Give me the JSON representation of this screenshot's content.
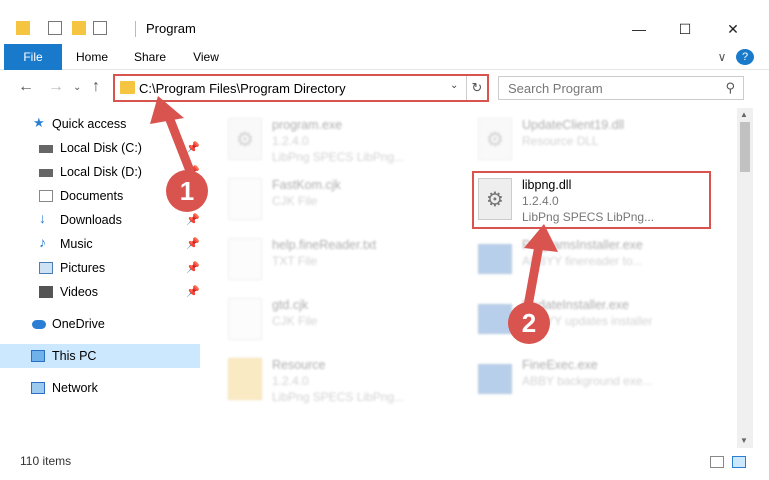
{
  "window": {
    "title": "Program",
    "controls": {
      "minimize": "—",
      "maximize": "☐",
      "close": "✕"
    }
  },
  "ribbon": {
    "tabs": [
      "File",
      "Home",
      "Share",
      "View"
    ],
    "expand": "∨",
    "help": "?"
  },
  "addressbar": {
    "path": "C:\\Program Files\\Program Directory",
    "search_placeholder": "Search Program"
  },
  "sidebar": {
    "items": [
      {
        "label": "Quick access",
        "icon": "star-icon",
        "pinned": false
      },
      {
        "label": "Local Disk (C:)",
        "icon": "drive-icon",
        "pinned": true
      },
      {
        "label": "Local Disk (D:)",
        "icon": "drive-icon",
        "pinned": true
      },
      {
        "label": "Documents",
        "icon": "documents-icon",
        "pinned": true
      },
      {
        "label": "Downloads",
        "icon": "download-icon",
        "pinned": true
      },
      {
        "label": "Music",
        "icon": "music-icon",
        "pinned": true
      },
      {
        "label": "Pictures",
        "icon": "pictures-icon",
        "pinned": true
      },
      {
        "label": "Videos",
        "icon": "videos-icon",
        "pinned": true
      },
      {
        "label": "OneDrive",
        "icon": "cloud-icon",
        "pinned": false
      },
      {
        "label": "This PC",
        "icon": "computer-icon",
        "pinned": false
      },
      {
        "label": "Network",
        "icon": "network-icon",
        "pinned": false
      }
    ]
  },
  "files": [
    {
      "name": "program.exe",
      "line1": "1.2.4.0",
      "line2": "LibPng SPECS LibPng...",
      "icon": "app"
    },
    {
      "name": "UpdateClient19.dll",
      "line1": "Resource DLL",
      "line2": "",
      "icon": "gear"
    },
    {
      "name": "FastKom.cjk",
      "line1": "CJK File",
      "line2": "",
      "icon": "doc"
    },
    {
      "name": "libpng.dll",
      "line1": "1.2.4.0",
      "line2": "LibPng SPECS LibPng...",
      "icon": "gear"
    },
    {
      "name": "help.fineReader.txt",
      "line1": "TXT File",
      "line2": "",
      "icon": "doc"
    },
    {
      "name": "ProgramsInstaller.exe",
      "line1": "ABBYY finereader to...",
      "line2": "",
      "icon": "exe"
    },
    {
      "name": "gtd.cjk",
      "line1": "CJK File",
      "line2": "",
      "icon": "doc"
    },
    {
      "name": "UpdateInstaller.exe",
      "line1": "ABBYY updates installer",
      "line2": "",
      "icon": "exe"
    },
    {
      "name": "Resource",
      "line1": "1.2.4.0",
      "line2": "LibPng SPECS LibPng...",
      "icon": "folder"
    },
    {
      "name": "FineExec.exe",
      "line1": "ABBY background exe...",
      "line2": "",
      "icon": "exe"
    }
  ],
  "status": {
    "items_count": "110 items"
  },
  "annotations": {
    "step1": "1",
    "step2": "2",
    "accent": "#d9534f"
  }
}
